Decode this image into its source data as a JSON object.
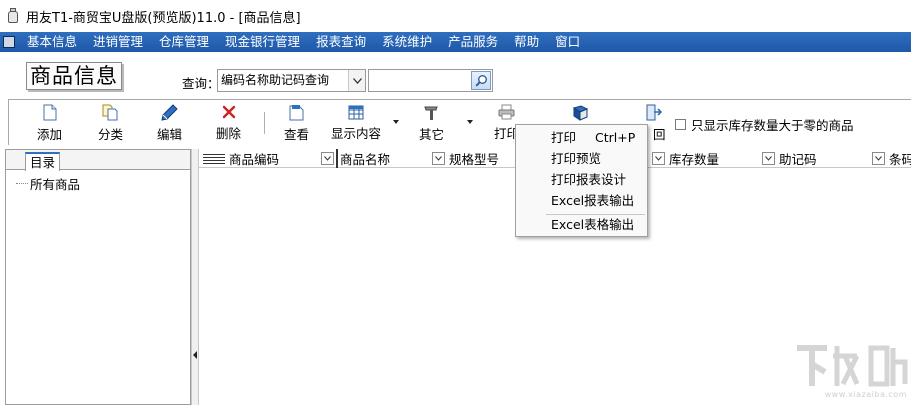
{
  "window": {
    "title": "用友T1-商贸宝U盘版(预览版)11.0 - [商品信息]",
    "app_icon": "app-icon"
  },
  "menubar": {
    "items": [
      "基本信息",
      "进销管理",
      "仓库管理",
      "现金银行管理",
      "报表查询",
      "系统维护",
      "产品服务",
      "帮助",
      "窗口"
    ]
  },
  "header": {
    "page_title": "商品信息",
    "query_label": "查询：",
    "query_select_value": "编码名称助记码查询",
    "search_value": ""
  },
  "toolbar": {
    "buttons": [
      {
        "label": "添加",
        "icon": "add-doc-icon"
      },
      {
        "label": "分类",
        "icon": "category-icon"
      },
      {
        "label": "编辑",
        "icon": "edit-pen-icon"
      },
      {
        "label": "删除",
        "icon": "delete-x-icon"
      },
      {
        "label": "查看",
        "icon": "view-icon"
      },
      {
        "label": "显示内容",
        "icon": "grid-display-icon"
      },
      {
        "label": "其它",
        "icon": "tools-icon"
      },
      {
        "label": "打印",
        "icon": "printer-icon"
      },
      {
        "label": "",
        "icon": "book-icon"
      },
      {
        "label": "回",
        "icon": "exit-door-icon"
      }
    ],
    "checkbox_label": "只显示库存数量大于零的商品",
    "checkbox_checked": false
  },
  "left_panel": {
    "tab_label": "目录",
    "tree_items": [
      "所有商品"
    ]
  },
  "grid": {
    "columns": [
      "商品编码",
      "商品名称",
      "规格型号",
      "库存数量",
      "助记码",
      "条码"
    ]
  },
  "popup_menu": {
    "items": [
      {
        "label": "打印",
        "shortcut": "Ctrl+P"
      },
      {
        "label": "打印预览",
        "shortcut": ""
      },
      {
        "label": "打印报表设计",
        "shortcut": ""
      },
      {
        "label": "Excel报表输出",
        "shortcut": ""
      },
      {
        "label": "Excel表格输出",
        "shortcut": ""
      }
    ]
  },
  "watermark": {
    "text": "www.xiazaiba.com"
  },
  "colors": {
    "menubar": "#1f58a8",
    "delete_red": "#cc2222",
    "icon_blue": "#2f6fbf"
  }
}
